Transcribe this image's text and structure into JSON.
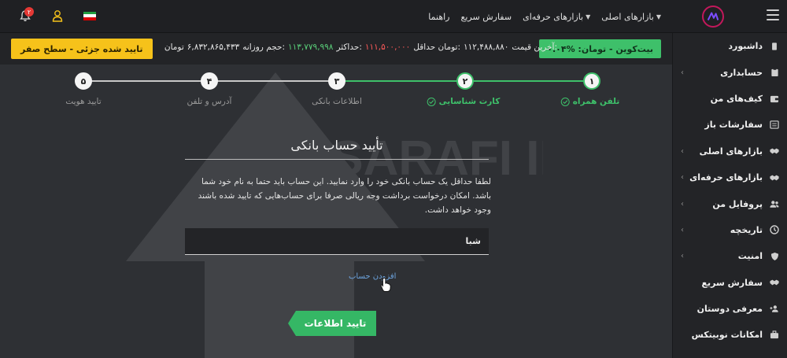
{
  "topbar": {
    "nav": [
      {
        "label": "بازارهای اصلی",
        "has_caret": true
      },
      {
        "label": "بازارهای حرفه‌ای",
        "has_caret": true
      },
      {
        "label": "سفارش سریع",
        "has_caret": false
      },
      {
        "label": "راهنما",
        "has_caret": false
      }
    ],
    "notification_count": "۲",
    "icons": [
      "menu-icon",
      "logo-icon",
      "bell-icon",
      "user-icon",
      "iran-flag-icon"
    ]
  },
  "ticker": {
    "pair_label": "بیت‌کوین - تومان: %۰.۰۴",
    "last_price_label": "آخرین قیمت:",
    "last_price": "۱۱۲,۴۸۸,۸۸۰",
    "min_label": "تومان حداقل:",
    "min_value": "۱۱۱,۵۰۰,۰۰۰",
    "max_label": "حداکثر:",
    "max_value": "۱۱۳,۷۷۹,۹۹۸",
    "volume_label": "حجم روزانه:",
    "volume_value": "۶,۸۳۲,۸۶۵,۴۳۳",
    "unit": "تومان",
    "level_badge": "تایید شده جزئی - سطح صفر",
    "colors": {
      "pair": "#3ec06a",
      "min": "#ff5a5a",
      "max": "#5ad07a",
      "level": "#f6c21a"
    }
  },
  "sidebar": {
    "items": [
      {
        "label": "داشبورد",
        "icon": "mobile-icon",
        "has_chevron": false
      },
      {
        "label": "حسابداری",
        "icon": "clipboard-icon",
        "has_chevron": true
      },
      {
        "label": "کیف‌های من",
        "icon": "wallet-icon",
        "has_chevron": false
      },
      {
        "label": "سفارشات باز",
        "icon": "list-icon",
        "has_chevron": false
      },
      {
        "label": "بازارهای اصلی",
        "icon": "handshake-icon",
        "has_chevron": true
      },
      {
        "label": "بازارهای حرفه‌ای",
        "icon": "handshake-icon",
        "has_chevron": true
      },
      {
        "label": "پروفایل من",
        "icon": "users-icon",
        "has_chevron": true
      },
      {
        "label": "تاریخچه",
        "icon": "history-icon",
        "has_chevron": true
      },
      {
        "label": "امنیت",
        "icon": "shield-icon",
        "has_chevron": true
      },
      {
        "label": "سفارش سریع",
        "icon": "handshake-icon",
        "has_chevron": false
      },
      {
        "label": "معرفی دوستان",
        "icon": "user-plus-icon",
        "has_chevron": false
      },
      {
        "label": "امکانات نوبیتکس",
        "icon": "toolbox-icon",
        "has_chevron": false
      }
    ]
  },
  "stepper": {
    "steps": [
      {
        "num": "۱",
        "label": "تلفن همراه",
        "done": true
      },
      {
        "num": "۲",
        "label": "کارت شناسایی",
        "done": true
      },
      {
        "num": "۳",
        "label": "اطلاعات بانکی",
        "done": false
      },
      {
        "num": "۴",
        "label": "آدرس و تلفن",
        "done": false
      },
      {
        "num": "۵",
        "label": "تایید هویت",
        "done": false
      }
    ]
  },
  "form": {
    "title": "تأیید حساب بانکی",
    "description": "لطفا حداقل یک حساب بانکی خود را وارد نمایید. این حساب باید حتما به نام خود شما باشد. امکان درخواست برداشت وجه ریالی صرفا برای حساب‌هایی که تایید شده باشند وجود خواهد داشت.",
    "sheba_placeholder": "شبا",
    "add_account": "افزودن حساب",
    "submit": "تایید اطلاعات"
  },
  "watermark": {
    "text": "SARAFI IRAN"
  }
}
